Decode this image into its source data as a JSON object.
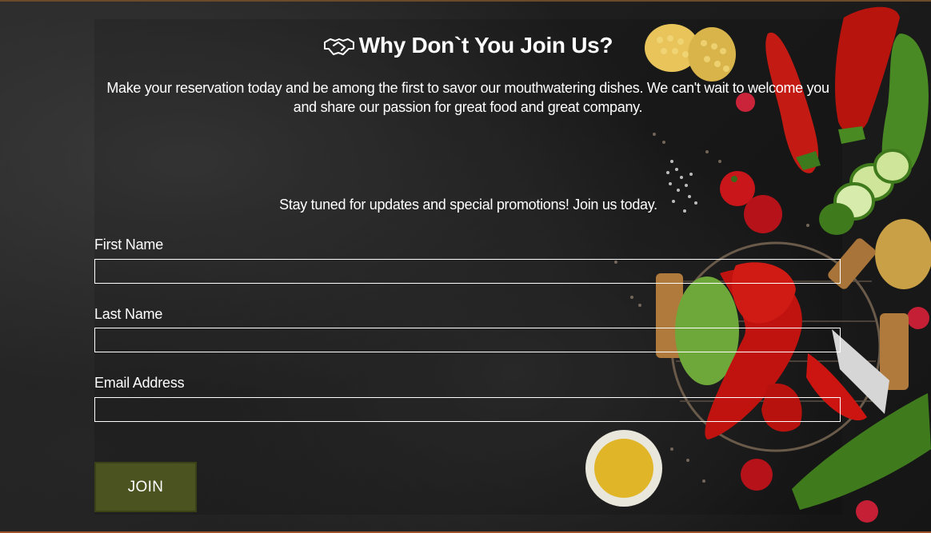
{
  "section": {
    "title": "Why Don`t You Join Us?",
    "title_icon": "handshake-icon",
    "intro": "Make your reservation today and be among the first to savor our mouthwatering dishes. We can't wait to welcome you and share our passion for great food and great company.",
    "promo": "Stay tuned for updates and special promotions! Join us today."
  },
  "form": {
    "first_name_label": "First Name",
    "first_name_value": "",
    "last_name_label": "Last Name",
    "last_name_value": "",
    "email_label": "Email Address",
    "email_value": "",
    "submit_label": "JOIN"
  },
  "colors": {
    "button_background": "#4b5320",
    "text": "#ffffff",
    "background": "#1e1e1e"
  }
}
